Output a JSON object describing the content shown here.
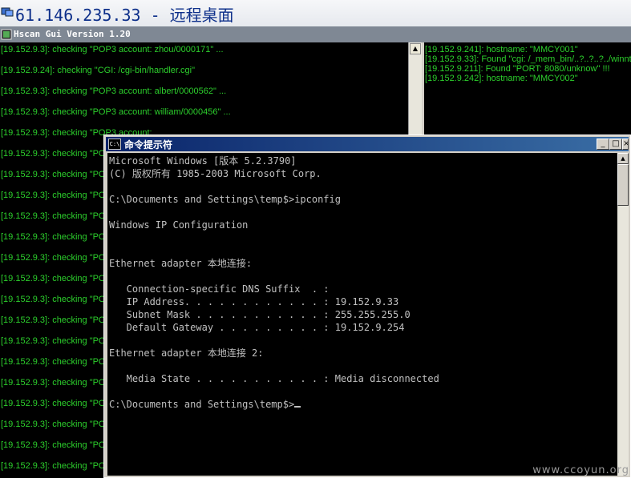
{
  "remote_desktop": {
    "title": "61.146.235.33 - 远程桌面",
    "icon": "remote-desktop-icon"
  },
  "hscan": {
    "title": "Hscan Gui Version 1.20",
    "left_log": [
      "[19.152.9.3]: checking \"POP3 account: zhou/0000171\" ...",
      "[19.152.9.24]: checking \"CGI: /cgi-bin/handler.cgi\"",
      "[19.152.9.3]: checking \"POP3 account: albert/0000562\" ...",
      "[19.152.9.3]: checking \"POP3 account: william/0000456\" ...",
      "[19.152.9.3]: checking \"POP3 account:",
      "[19.152.9.3]: checking \"PO",
      "[19.152.9.3]: checking \"PO",
      "[19.152.9.3]: checking \"PO",
      "[19.152.9.3]: checking \"PO",
      "[19.152.9.3]: checking \"PO",
      "[19.152.9.3]: checking \"PO",
      "[19.152.9.3]: checking \"PO",
      "[19.152.9.3]: checking \"PO",
      "[19.152.9.3]: checking \"PO",
      "[19.152.9.3]: checking \"PO",
      "[19.152.9.3]: checking \"PO",
      "[19.152.9.3]: checking \"PO",
      "[19.152.9.3]: checking \"PO",
      "[19.152.9.3]: checking \"PO",
      "[19.152.9.3]: checking \"PO",
      "[19.152.9.3]: checking \"PO",
      "[19.152.9.3]: checking \"PO"
    ],
    "right_log": [
      "[19.152.9.241]: hostname: \"MMCY001\"",
      "[19.152.9.33]: Found \"cgi: /_mem_bin/..?..?..?../winnt",
      "[19.152.9.211]: Found \"PORT: 8080/unknow\" !!!",
      "[19.152.9.242]: hostname: \"MMCY002\""
    ]
  },
  "cmd": {
    "title": "命令提示符",
    "icon_text": "C:\\",
    "buttons": {
      "minimize": "_",
      "maximize": "□",
      "close": "×"
    },
    "lines": [
      "Microsoft Windows [版本 5.2.3790]",
      "(C) 版权所有 1985-2003 Microsoft Corp.",
      "",
      "C:\\Documents and Settings\\temp$>ipconfig",
      "",
      "Windows IP Configuration",
      "",
      "",
      "Ethernet adapter 本地连接:",
      "",
      "   Connection-specific DNS Suffix  . :",
      "   IP Address. . . . . . . . . . . . : 19.152.9.33",
      "   Subnet Mask . . . . . . . . . . . : 255.255.255.0",
      "   Default Gateway . . . . . . . . . : 19.152.9.254",
      "",
      "Ethernet adapter 本地连接 2:",
      "",
      "   Media State . . . . . . . . . . . : Media disconnected",
      "",
      "C:\\Documents and Settings\\temp$>"
    ]
  },
  "watermark": "www.ccoyun.org"
}
